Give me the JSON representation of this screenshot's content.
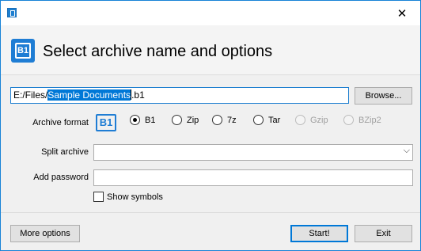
{
  "window": {
    "close_glyph": "✕",
    "app_icon": "b1-app-icon"
  },
  "header": {
    "title": "Select archive name and options",
    "logo_text": "B1"
  },
  "path": {
    "prefix": "E:/Files/",
    "selected": "Sample Documents",
    "suffix": ".b1",
    "browse_label": "Browse..."
  },
  "format": {
    "label": "Archive format",
    "logo_text": "B1",
    "options": [
      {
        "label": "B1",
        "checked": true,
        "enabled": true
      },
      {
        "label": "Zip",
        "checked": false,
        "enabled": true
      },
      {
        "label": "7z",
        "checked": false,
        "enabled": true
      },
      {
        "label": "Tar",
        "checked": false,
        "enabled": true
      },
      {
        "label": "Gzip",
        "checked": false,
        "enabled": false
      },
      {
        "label": "BZip2",
        "checked": false,
        "enabled": false
      }
    ]
  },
  "split": {
    "label": "Split archive",
    "value": "",
    "chevron": "⌵"
  },
  "password": {
    "label": "Add password",
    "value": ""
  },
  "show_symbols": {
    "label": "Show symbols",
    "checked": false
  },
  "footer": {
    "more_options": "More options",
    "start": "Start!",
    "exit": "Exit"
  },
  "colors": {
    "accent": "#1f7dd4",
    "selection": "#0078d7"
  }
}
